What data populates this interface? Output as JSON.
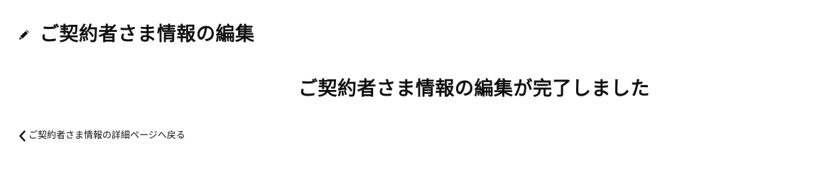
{
  "header": {
    "icon": "pencil-icon",
    "title": "ご契約者さま情報の編集"
  },
  "main": {
    "completion_message": "ご契約者さま情報の編集が完了しました"
  },
  "footer": {
    "back_link_icon": "chevron-left-icon",
    "back_link_label": "ご契約者さま情報の詳細ページへ戻る"
  },
  "colors": {
    "text": "#111111",
    "background": "#ffffff"
  }
}
